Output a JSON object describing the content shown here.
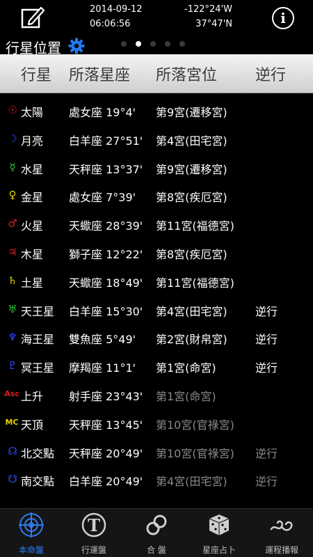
{
  "topbar": {
    "date": "2014-09-12",
    "time": "06:06:56",
    "longitude": "-122°24'W",
    "latitude": "37°47'N",
    "edit_icon": "edit-icon",
    "info_icon": "info-icon"
  },
  "section": {
    "title": "行星位置",
    "settings_icon": "gear-icon",
    "page_count": 5,
    "page_index": 1
  },
  "table": {
    "headers": [
      "行星",
      "所落星座",
      "所落宮位",
      "逆行"
    ],
    "rows": [
      {
        "symbol": "☉",
        "name": "太陽",
        "sign": "處女座 19°4'",
        "house": "第9宮(遷移宮)",
        "retro": "",
        "color": "#e01a1a"
      },
      {
        "symbol": "☽",
        "name": "月亮",
        "sign": "白羊座 27°51'",
        "house": "第4宮(田宅宮)",
        "retro": "",
        "color": "#2a4cff"
      },
      {
        "symbol": "☿",
        "name": "水星",
        "sign": "天秤座 13°37'",
        "house": "第9宮(遷移宮)",
        "retro": "",
        "color": "#2ec82e"
      },
      {
        "symbol": "♀",
        "name": "金星",
        "sign": "處女座 7°39'",
        "house": "第8宮(疾厄宮)",
        "retro": "",
        "color": "#e6d200"
      },
      {
        "symbol": "♂",
        "name": "火星",
        "sign": "天蠍座 28°39'",
        "house": "第11宮(福德宮)",
        "retro": "",
        "color": "#e01a1a"
      },
      {
        "symbol": "♃",
        "name": "木星",
        "sign": "獅子座 12°22'",
        "house": "第8宮(疾厄宮)",
        "retro": "",
        "color": "#e01a1a"
      },
      {
        "symbol": "♄",
        "name": "土星",
        "sign": "天蠍座 18°49'",
        "house": "第11宮(福德宮)",
        "retro": "",
        "color": "#e6d200"
      },
      {
        "symbol": "♅",
        "name": "天王星",
        "sign": "白羊座 15°30'",
        "house": "第4宮(田宅宮)",
        "retro": "逆行",
        "color": "#2ec82e"
      },
      {
        "symbol": "♆",
        "name": "海王星",
        "sign": "雙魚座 5°49'",
        "house": "第2宮(財帛宮)",
        "retro": "逆行",
        "color": "#2a4cff"
      },
      {
        "symbol": "♇",
        "name": "冥王星",
        "sign": "摩羯座 11°1'",
        "house": "第1宮(命宮)",
        "retro": "逆行",
        "color": "#2a4cff"
      },
      {
        "symbol": "Asc",
        "name": "上升",
        "sign": "射手座 23°43'",
        "house": "第1宮(命宮)",
        "retro": "",
        "color": "#e01a1a",
        "dim": true
      },
      {
        "symbol": "MC",
        "name": "天頂",
        "sign": "天秤座 13°45'",
        "house": "第10宮(官祿宮)",
        "retro": "",
        "color": "#e6d200",
        "dim": true
      },
      {
        "symbol": "☊",
        "name": "北交點",
        "sign": "天秤座 20°49'",
        "house": "第10宮(官祿宮)",
        "retro": "逆行",
        "color": "#2a4cff",
        "dim": true
      },
      {
        "symbol": "☋",
        "name": "南交點",
        "sign": "白羊座 20°49'",
        "house": "第4宮(田宅宮)",
        "retro": "逆行",
        "color": "#2a4cff",
        "dim": true
      }
    ]
  },
  "tabs": [
    {
      "label": "本命盤",
      "icon": "crosshair-icon",
      "active": true
    },
    {
      "label": "行運盤",
      "icon": "letter-t-icon",
      "active": false
    },
    {
      "label": "合 盤",
      "icon": "rings-icon",
      "active": false
    },
    {
      "label": "星座占卜",
      "icon": "dice-icon",
      "active": false
    },
    {
      "label": "運程播報",
      "icon": "cloud-swirl-icon",
      "active": false
    }
  ]
}
